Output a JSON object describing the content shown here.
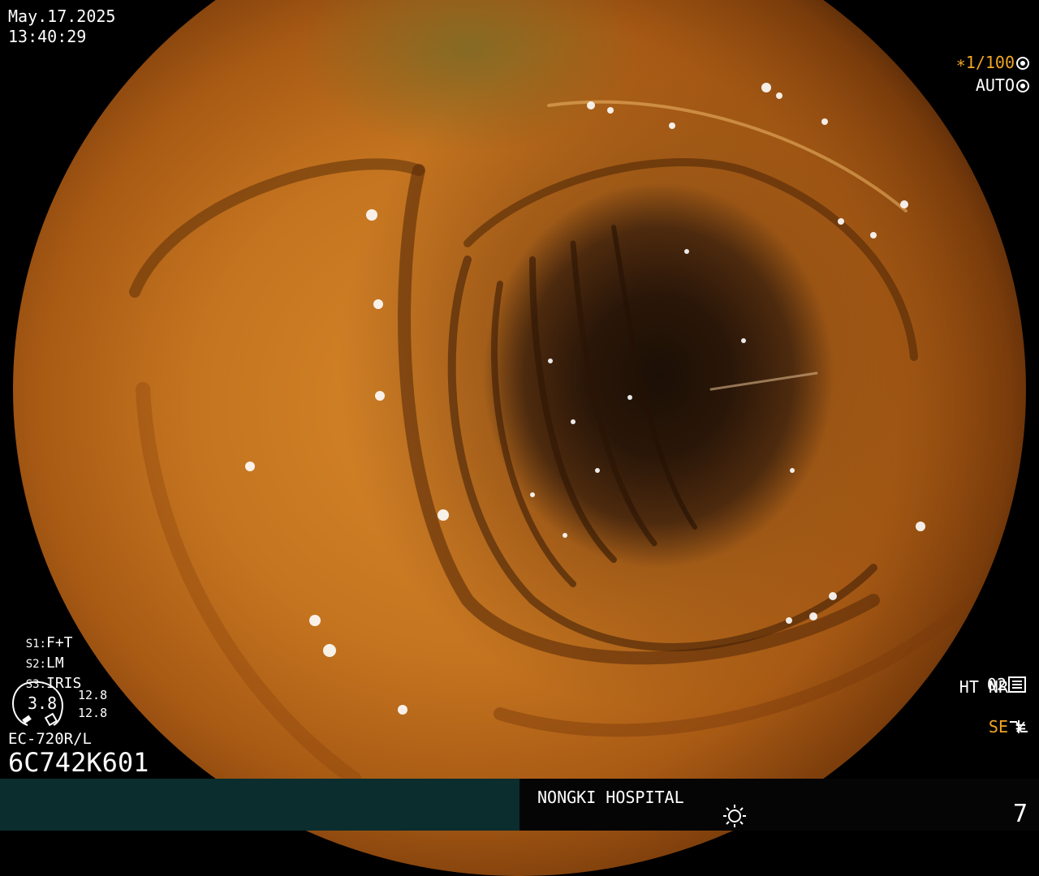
{
  "datetime": {
    "date": "May.17.2025",
    "time": "13:40:29"
  },
  "shutter": {
    "value": "∗1/100",
    "icon": "shutter-icon",
    "accent": "#f2a623"
  },
  "iris_mode": {
    "value": "AUTO",
    "icon": "iris-icon"
  },
  "settings": [
    {
      "key": "S1:",
      "value": "F+T"
    },
    {
      "key": "S2:",
      "value": "LM"
    },
    {
      "key": "S3:",
      "value": "IRIS"
    }
  ],
  "gauge": {
    "center": "3.8",
    "upper": "12.8",
    "lower": "12.8"
  },
  "scope_model": "EC-720R/L",
  "serial": "6C742K601",
  "processing": {
    "mode_number": "02",
    "mode_icon": "preset-icon",
    "ht_nr": "HT NR",
    "se": "SE",
    "se_icon": "curve-icon",
    "freeze_icon": "not-equal-icon"
  },
  "footer": {
    "hospital": "NONGKI HOSPITAL",
    "light_icon": "brightness-icon",
    "page_number": "7"
  },
  "colors": {
    "mucosa": "#c4741f",
    "lumen": "#1c0f05",
    "footer_left": "#0b2d2d"
  }
}
